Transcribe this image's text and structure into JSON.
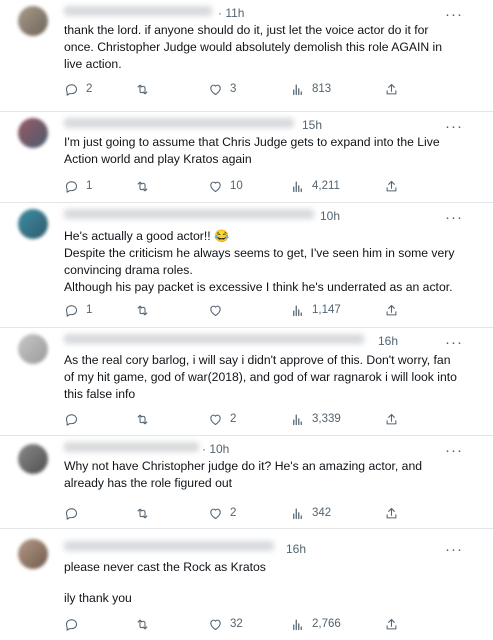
{
  "replies": [
    {
      "time": "· 11h",
      "lines": [
        "thank the lord. if anyone should do it, just let the voice actor do it for once. Christopher Judge would absolutely demolish this role AGAIN in live action."
      ],
      "stats": {
        "replies": "2",
        "reposts": "",
        "likes": "3",
        "views": "813"
      },
      "avatar_color": "#8a7f72"
    },
    {
      "time": "15h",
      "lines": [
        "I'm just going to assume that Chris Judge gets to expand into the Live Action world and play Kratos again"
      ],
      "stats": {
        "replies": "1",
        "reposts": "",
        "likes": "10",
        "views": "4,211"
      },
      "avatar_color": "#7b4a52"
    },
    {
      "time": "10h",
      "lines": [
        "He's actually a good actor!! 😂",
        "Despite the criticism he always seems to get, I've seen him in some very convincing drama roles.",
        "Although his pay packet is excessive I think he's underrated as an actor."
      ],
      "stats": {
        "replies": "1",
        "reposts": "",
        "likes": "",
        "views": "1,147"
      },
      "avatar_color": "#3a7f95"
    },
    {
      "time": "16h",
      "lines": [
        "As the real cory barlog, i will say i didn't approve of this. Don't worry, fan of my hit game, god of war(2018), and god of war ragnarok i will look into this false info"
      ],
      "stats": {
        "replies": "",
        "reposts": "",
        "likes": "2",
        "views": "3,339"
      },
      "avatar_color": "#b4b4b4"
    },
    {
      "time": "· 10h",
      "lines": [
        "Why not have Christopher judge do it? He's an amazing actor, and already has the role figured out"
      ],
      "stats": {
        "replies": "",
        "reposts": "",
        "likes": "2",
        "views": "342"
      },
      "avatar_color": "#6f6f6f"
    },
    {
      "time": "16h",
      "lines": [
        "please never cast the Rock as Kratos",
        "ily thank you"
      ],
      "stats": {
        "replies": "",
        "reposts": "",
        "likes": "32",
        "views": "2,766"
      },
      "avatar_color": "#a08a7a"
    }
  ],
  "more_label": "···",
  "icons": {
    "reply": "reply-icon",
    "repost": "repost-icon",
    "like": "heart-icon",
    "views": "views-icon",
    "share": "share-icon"
  }
}
